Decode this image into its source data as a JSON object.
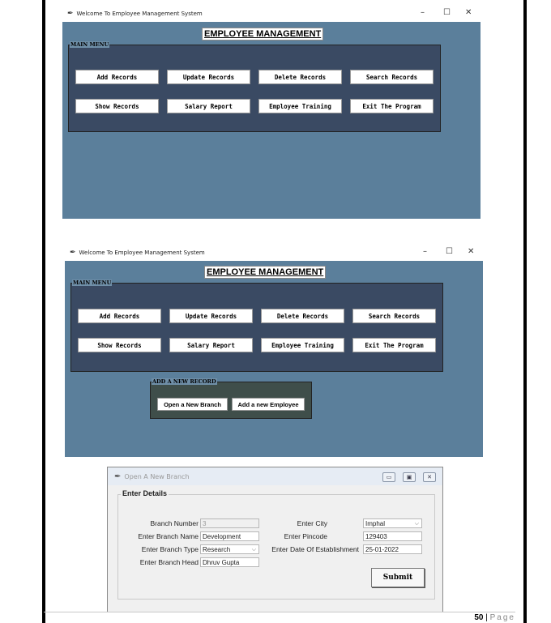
{
  "window1": {
    "title": "Welcome To Employee Management System",
    "heading": "EMPLOYEE MANAGEMENT",
    "main_menu_label": "MAIN MENU",
    "buttons": [
      "Add Records",
      "Update Records",
      "Delete Records",
      "Search Records",
      "Show Records",
      "Salary Report",
      "Employee Training",
      "Exit The Program"
    ]
  },
  "window2": {
    "title": "Welcome To Employee Management System",
    "heading": "EMPLOYEE MANAGEMENT",
    "main_menu_label": "MAIN MENU",
    "buttons": [
      "Add Records",
      "Update Records",
      "Delete Records",
      "Search Records",
      "Show Records",
      "Salary Report",
      "Employee Training",
      "Exit The Program"
    ],
    "add_frame_label": "ADD A NEW RECORD",
    "add_buttons": [
      "Open a New Branch",
      "Add a new Employee"
    ]
  },
  "controls": {
    "minimize": "–",
    "maximize": "☐",
    "close": "✕"
  },
  "dialog": {
    "title": "Open A New Branch",
    "group_label": "Enter Details",
    "labels": {
      "branch_number": "Branch Number",
      "branch_name": "Enter Branch Name",
      "branch_type": "Enter Branch Type",
      "branch_head": "Enter Branch Head",
      "city": "Enter City",
      "pincode": "Enter Pincode",
      "date": "Enter Date Of Establishment"
    },
    "values": {
      "branch_number": "3",
      "branch_name": "Development",
      "branch_type": "Research",
      "branch_head": "Dhruv Gupta",
      "city": "Imphal",
      "pincode": "129403",
      "date": "25-01-2022"
    },
    "submit": "Submit"
  },
  "footer": {
    "page_number": "50",
    "separator": "|",
    "page_word": "Page"
  }
}
